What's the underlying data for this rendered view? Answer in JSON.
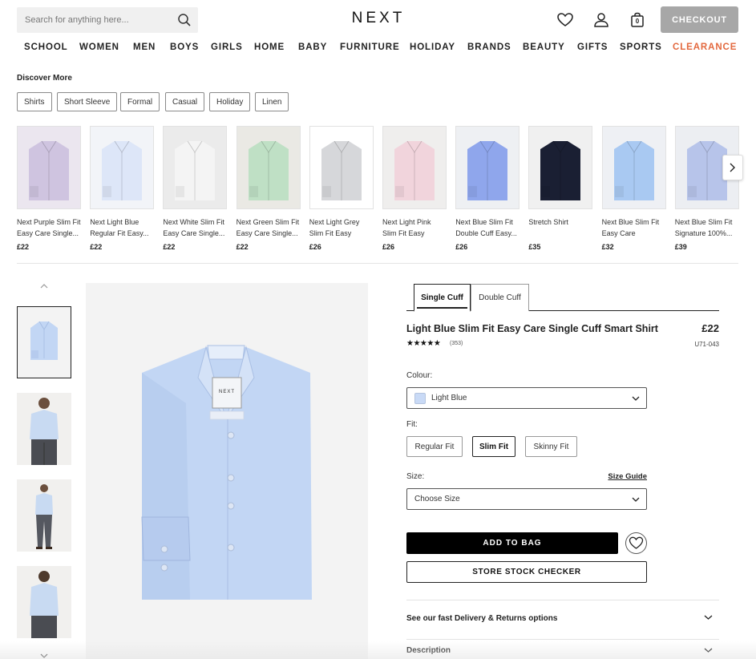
{
  "header": {
    "search_placeholder": "Search for anything here...",
    "logo": "NEXT",
    "bag_count": "0",
    "checkout_label": "CHECKOUT"
  },
  "nav": [
    {
      "label": "SCHOOL"
    },
    {
      "label": "WOMEN"
    },
    {
      "label": "MEN"
    },
    {
      "label": "BOYS"
    },
    {
      "label": "GIRLS"
    },
    {
      "label": "HOME"
    },
    {
      "label": "BABY"
    },
    {
      "label": "FURNITURE"
    },
    {
      "label": "HOLIDAY"
    },
    {
      "label": "BRANDS"
    },
    {
      "label": "BEAUTY"
    },
    {
      "label": "GIFTS"
    },
    {
      "label": "SPORTS"
    },
    {
      "label": "CLEARANCE"
    }
  ],
  "discover": {
    "title": "Discover More",
    "chips": [
      "Shirts",
      "Short Sleeve",
      "Formal",
      "Casual",
      "Holiday",
      "Linen"
    ]
  },
  "carousel": [
    {
      "name": "Next Purple Slim Fit Easy Care Single...",
      "price": "£22",
      "color": "#cfc4e0",
      "bg": "#ebe6ef"
    },
    {
      "name": "Next Light Blue Regular Fit Easy...",
      "price": "£22",
      "color": "#dde6f8",
      "bg": "#f2f4f8"
    },
    {
      "name": "Next White Slim Fit Easy Care Single...",
      "price": "£22",
      "color": "#f4f4f4",
      "bg": "#ebebeb"
    },
    {
      "name": "Next Green Slim Fit Easy Care Single...",
      "price": "£22",
      "color": "#bfe0c5",
      "bg": "#eae9e4"
    },
    {
      "name": "Next Light Grey Slim Fit Easy Care...",
      "price": "£26",
      "color": "#d6d7da",
      "bg": "#ffffff"
    },
    {
      "name": "Next Light Pink Slim Fit Easy Care...",
      "price": "£26",
      "color": "#f1d4dc",
      "bg": "#efeeed"
    },
    {
      "name": "Next Blue Slim Fit Double Cuff Easy...",
      "price": "£26",
      "color": "#8fa6ec",
      "bg": "#eef0f3"
    },
    {
      "name": "Stretch Shirt",
      "price": "£35",
      "color": "#1a1f33",
      "bg": "#f0f0f0"
    },
    {
      "name": "Next Blue Slim Fit Easy Care Texture...",
      "price": "£32",
      "color": "#a9c9f2",
      "bg": "#eef0f4"
    },
    {
      "name": "Next Blue Slim Fit Signature 100%...",
      "price": "£39",
      "color": "#b7c4ea",
      "bg": "#eceef2"
    }
  ],
  "product": {
    "tabs": [
      "Single Cuff",
      "Double Cuff"
    ],
    "title": "Light Blue Slim Fit Easy Care Single Cuff Smart Shirt",
    "price": "£22",
    "stars": "★★★★★",
    "reviews": "(353)",
    "sku": "U71-043",
    "colour_label": "Colour:",
    "colour_value": "Light Blue",
    "fit_label": "Fit:",
    "fits": [
      "Regular Fit",
      "Slim Fit",
      "Skinny Fit"
    ],
    "size_label": "Size:",
    "size_guide": "Size Guide",
    "size_value": "Choose Size",
    "add_to_bag": "ADD TO BAG",
    "store_stock": "STORE STOCK CHECKER",
    "accordion": [
      "See our fast Delivery & Returns options",
      "Description"
    ],
    "shirt_color": "#c2d6f4",
    "label_text": "NEXT"
  },
  "colors": {
    "accent_sale": "#e3693f",
    "checkout_bg": "#a7a7a7"
  }
}
